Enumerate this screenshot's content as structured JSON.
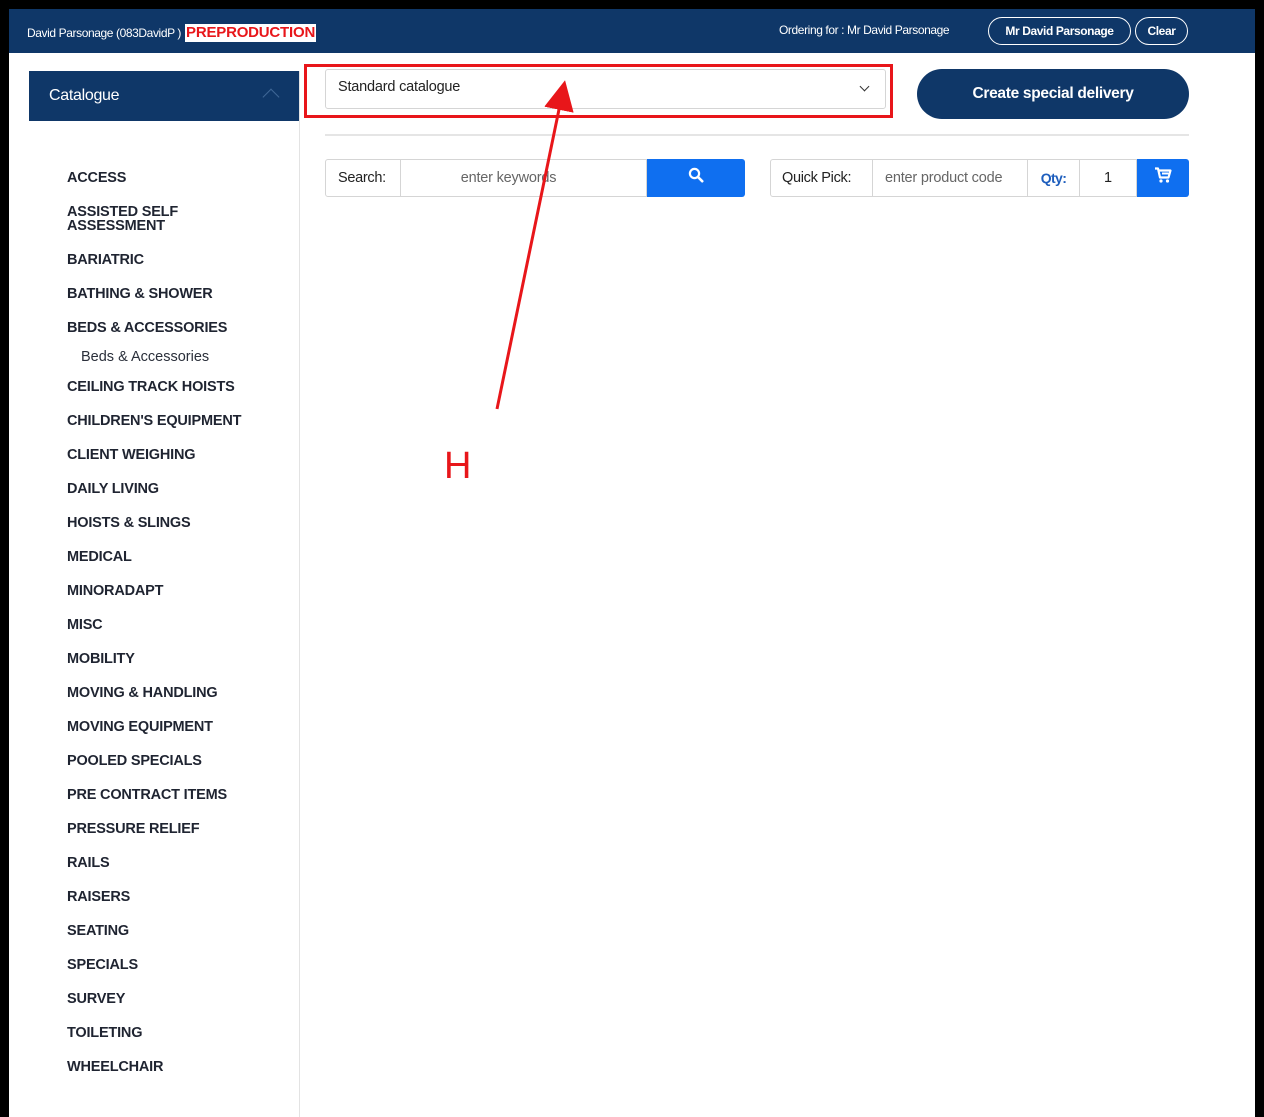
{
  "topbar": {
    "user_info": "David Parsonage (083DavidP )",
    "environment": "PREPRODUCTION",
    "ordering_for": "Ordering for : Mr David Parsonage",
    "user_button": "Mr David Parsonage",
    "clear_button": "Clear"
  },
  "sidebar": {
    "title": "Catalogue",
    "items": [
      "ACCESS",
      "ASSISTED SELF ASSESSMENT",
      "BARIATRIC",
      "BATHING & SHOWER",
      "BEDS & ACCESSORIES",
      "CEILING TRACK HOISTS",
      "CHILDREN'S EQUIPMENT",
      "CLIENT WEIGHING",
      "DAILY LIVING",
      "HOISTS & SLINGS",
      "MEDICAL",
      "MINORADAPT",
      "MISC",
      "MOBILITY",
      "MOVING & HANDLING",
      "MOVING EQUIPMENT",
      "POOLED SPECIALS",
      "PRE CONTRACT ITEMS",
      "PRESSURE RELIEF",
      "RAILS",
      "RAISERS",
      "SEATING",
      "SPECIALS",
      "SURVEY",
      "TOILETING",
      "WHEELCHAIR"
    ],
    "subitem": "Beds & Accessories"
  },
  "main": {
    "catalogue_select": "Standard catalogue",
    "special_delivery_button": "Create special delivery",
    "search_label": "Search:",
    "search_placeholder": "enter keywords",
    "quick_pick_label": "Quick Pick:",
    "quick_pick_placeholder": "enter product code",
    "qty_label": "Qty:",
    "qty_value": "1"
  },
  "annotation": {
    "label": "H",
    "color": "#e8161a"
  },
  "colors": {
    "navy": "#0f3768",
    "blue": "#0f6ff0",
    "red": "#e8161a"
  }
}
